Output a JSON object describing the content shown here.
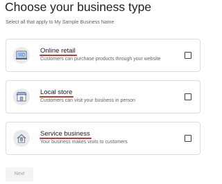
{
  "header": {
    "title": "Choose your business type",
    "subtitle": "Select all that apply to My Sample Business Name"
  },
  "options": [
    {
      "title": "Online retail",
      "description": "Customers can purchase products through your website",
      "icon": "computer-cart-icon",
      "checked": false
    },
    {
      "title": "Local store",
      "description": "Customers can visit your business in person",
      "icon": "storefront-icon",
      "checked": false
    },
    {
      "title": "Service business",
      "description": "Your business makes visits to customers",
      "icon": "home-service-icon",
      "checked": false
    }
  ],
  "footer": {
    "next_label": "Next"
  },
  "colors": {
    "annotation_underline": "#d93025",
    "icon_circle": "#e8eaed",
    "icon_accent": "#8ab4f8",
    "button_disabled_bg": "#f1f3f4"
  }
}
